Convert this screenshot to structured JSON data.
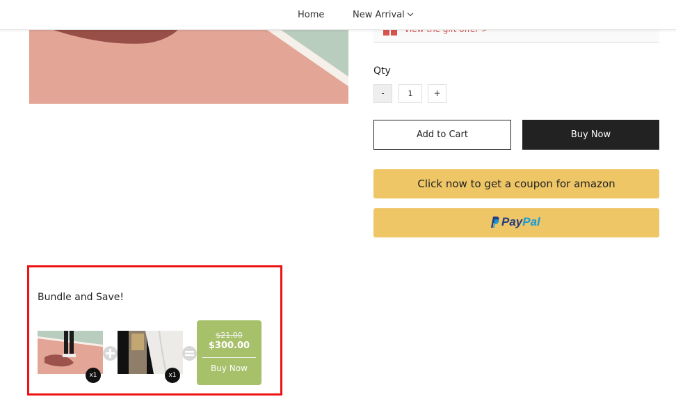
{
  "nav": {
    "home": "Home",
    "new_arrival": "New Arrival"
  },
  "gift": {
    "text": "View the gift offer >"
  },
  "qty": {
    "label": "Qty",
    "minus": "-",
    "value": "1",
    "plus": "+"
  },
  "actions": {
    "add_to_cart": "Add to Cart",
    "buy_now": "Buy Now",
    "coupon": "Click now to get a coupon for amazon",
    "paypal_pay": "Pay",
    "paypal_pal": "Pal"
  },
  "bundle": {
    "title": "Bundle and Save!",
    "items": [
      {
        "qty": "x1"
      },
      {
        "qty": "x1"
      }
    ],
    "old_price": "$21.00",
    "new_price": "$300.00",
    "buy_label": "Buy Now"
  },
  "colors": {
    "accent_gold": "#eec666",
    "bundle_green": "#a7c06a",
    "highlight_red": "#ee1111",
    "dark": "#222222"
  }
}
